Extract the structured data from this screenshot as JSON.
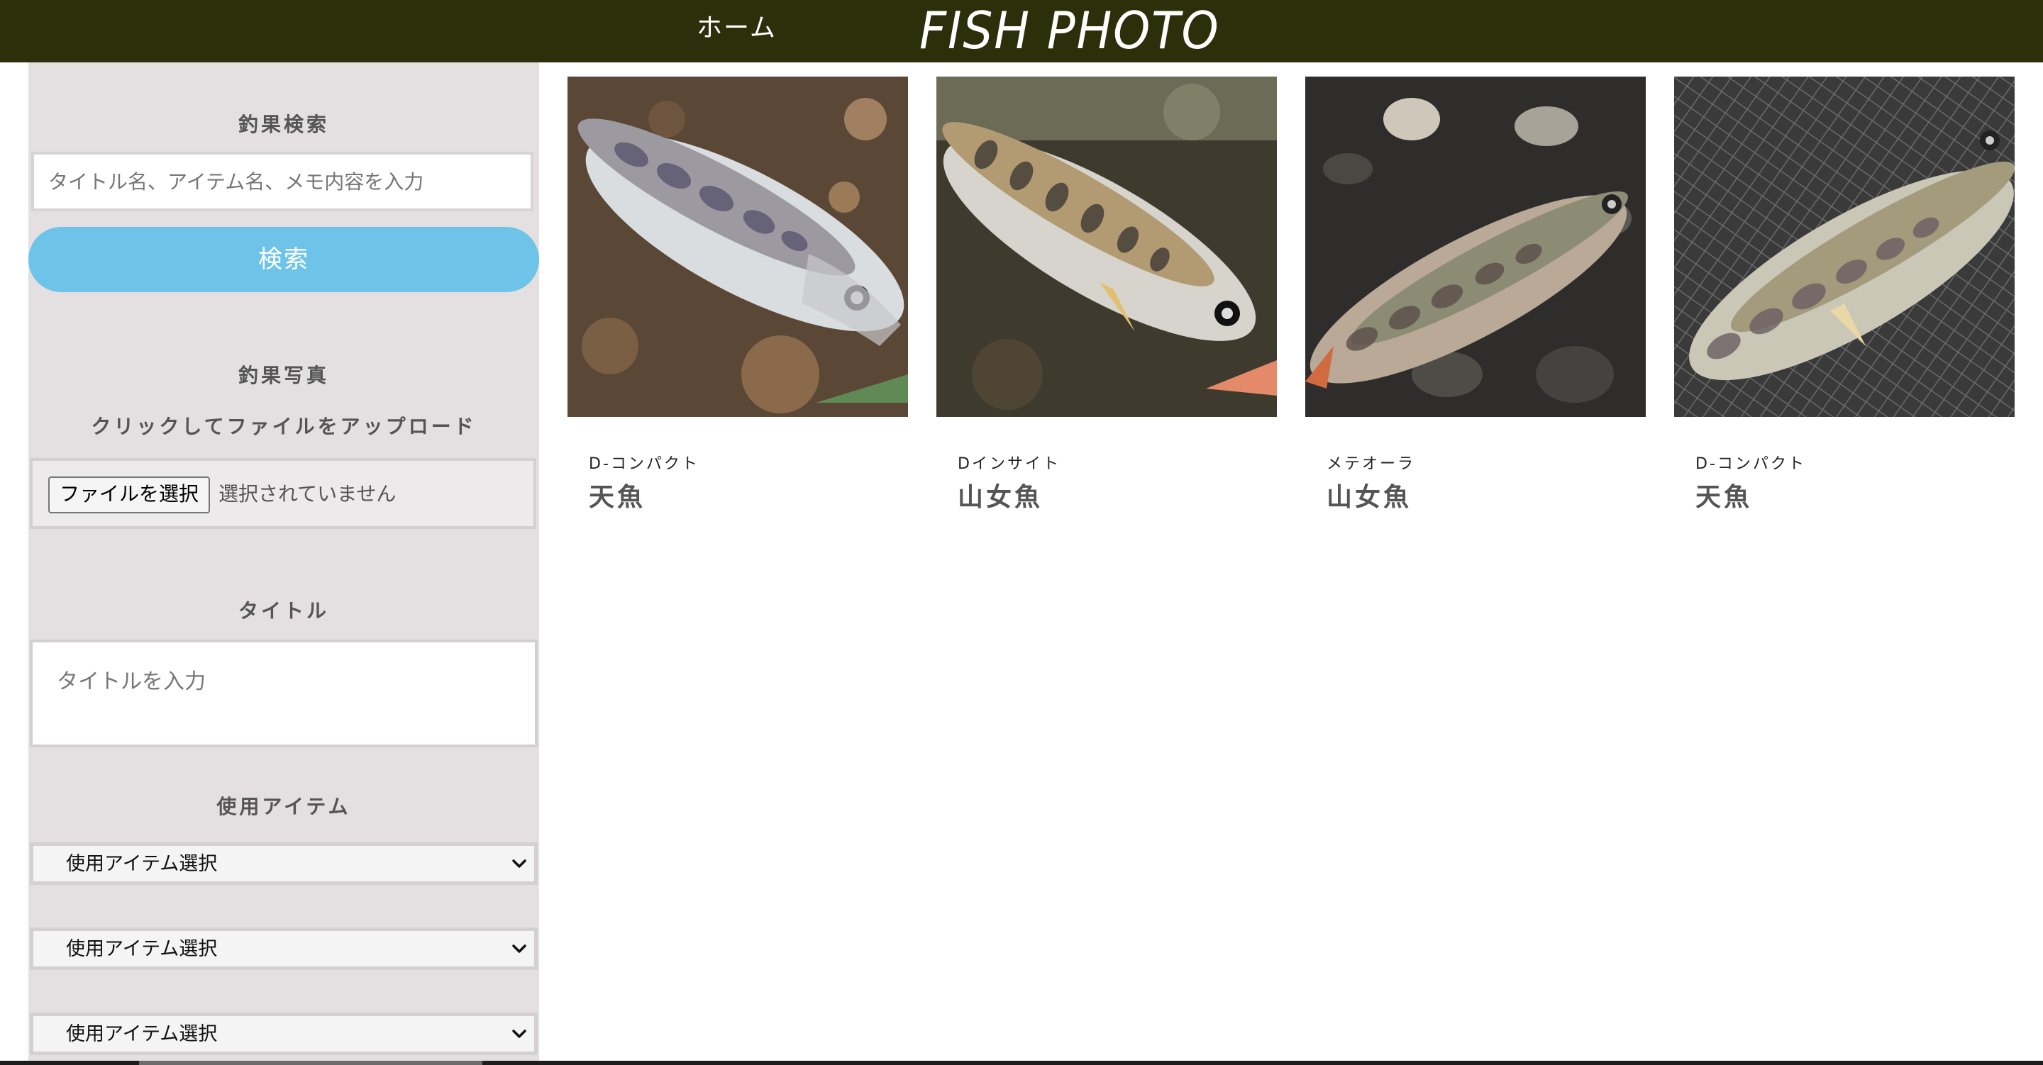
{
  "header": {
    "nav_home": "ホーム",
    "logo": "FISH PHOTO",
    "background_color": "#2b300b"
  },
  "sidebar": {
    "search": {
      "title": "釣果検索",
      "placeholder": "タイトル名、アイテム名、メモ内容を入力",
      "button_label": "検索",
      "button_color": "#6ec3e8"
    },
    "photo": {
      "title": "釣果写真",
      "subtitle": "クリックしてファイルをアップロード",
      "file_button": "ファイルを選択",
      "file_status": "選択されていません"
    },
    "title_field": {
      "title": "タイトル",
      "placeholder": "タイトルを入力"
    },
    "items": {
      "title": "使用アイテム",
      "selects": [
        {
          "selected": "使用アイテム選択"
        },
        {
          "selected": "使用アイテム選択"
        },
        {
          "selected": "使用アイテム選択"
        }
      ]
    }
  },
  "gallery": [
    {
      "item": "D-コンパクト",
      "fish": "天魚"
    },
    {
      "item": "Dインサイト",
      "fish": "山女魚"
    },
    {
      "item": "メテオーラ",
      "fish": "山女魚"
    },
    {
      "item": "D-コンパクト",
      "fish": "天魚"
    }
  ]
}
